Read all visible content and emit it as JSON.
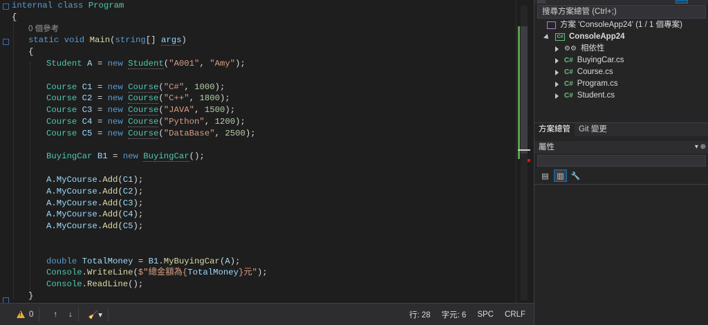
{
  "editor": {
    "code_lines": [
      {
        "kind": "class_decl",
        "kw1": "internal",
        "kw2": "class",
        "name": "Program"
      },
      {
        "kind": "brace",
        "text": "{"
      },
      {
        "kind": "hint",
        "text": "0 個參考"
      },
      {
        "kind": "method",
        "kw1": "static",
        "kw2": "void",
        "name": "Main",
        "p_open": "(",
        "ptype": "string",
        "pbr": "[]",
        "pname": "args",
        "p_close": ")"
      },
      {
        "kind": "brace",
        "text": "{"
      },
      {
        "kind": "new_obj",
        "type": "Student",
        "var": "A",
        "args": [
          {
            "s": "\"A001\""
          },
          {
            "s": "\"Amy\""
          }
        ]
      },
      {
        "kind": "blank"
      },
      {
        "kind": "new_obj",
        "type": "Course",
        "var": "C1",
        "args": [
          {
            "s": "\"C#\""
          },
          {
            "n": "1000"
          }
        ]
      },
      {
        "kind": "new_obj",
        "type": "Course",
        "var": "C2",
        "args": [
          {
            "s": "\"C++\""
          },
          {
            "n": "1800"
          }
        ]
      },
      {
        "kind": "new_obj",
        "type": "Course",
        "var": "C3",
        "args": [
          {
            "s": "\"JAVA\""
          },
          {
            "n": "1500"
          }
        ]
      },
      {
        "kind": "new_obj",
        "type": "Course",
        "var": "C4",
        "args": [
          {
            "s": "\"Python\""
          },
          {
            "n": "1200"
          }
        ]
      },
      {
        "kind": "new_obj",
        "type": "Course",
        "var": "C5",
        "args": [
          {
            "s": "\"DataBase\""
          },
          {
            "n": "2500"
          }
        ]
      },
      {
        "kind": "blank"
      },
      {
        "kind": "new_obj",
        "type": "BuyingCar",
        "var": "B1",
        "args": []
      },
      {
        "kind": "blank"
      },
      {
        "kind": "call",
        "obj": "A",
        "prop": "MyCourse",
        "fn": "Add",
        "arg": "C1"
      },
      {
        "kind": "call",
        "obj": "A",
        "prop": "MyCourse",
        "fn": "Add",
        "arg": "C2"
      },
      {
        "kind": "call",
        "obj": "A",
        "prop": "MyCourse",
        "fn": "Add",
        "arg": "C3"
      },
      {
        "kind": "call",
        "obj": "A",
        "prop": "MyCourse",
        "fn": "Add",
        "arg": "C4"
      },
      {
        "kind": "call",
        "obj": "A",
        "prop": "MyCourse",
        "fn": "Add",
        "arg": "C5"
      },
      {
        "kind": "blank"
      },
      {
        "kind": "blank"
      },
      {
        "kind": "assign_call",
        "tkw": "double",
        "var": "TotalMoney",
        "obj": "B1",
        "fn": "MyBuyingCar",
        "arg": "A"
      },
      {
        "kind": "writeline",
        "cls": "Console",
        "fn": "WriteLine",
        "s1": "$\"總金額為{",
        "interp": "TotalMoney",
        "s2": "}元\""
      },
      {
        "kind": "readline",
        "cls": "Console",
        "fn": "ReadLine"
      },
      {
        "kind": "brace",
        "text": "}"
      }
    ]
  },
  "statusbar": {
    "warnings": "0",
    "line": "行: 28",
    "col": "字元: 6",
    "spacing": "SPC",
    "line_ending": "CRLF"
  },
  "solution_explorer": {
    "search_placeholder": "搜尋方案總管 (Ctrl+;)",
    "solution_label": "方案 'ConsoleApp24' (1 / 1 個專案)",
    "project_label": "ConsoleApp24",
    "project_icon_text": "C#",
    "dependencies_label": "相依性",
    "file_icon_text": "C#",
    "files": [
      "BuyingCar.cs",
      "Course.cs",
      "Program.cs",
      "Student.cs"
    ],
    "tabs": [
      "方案總管",
      "Git 變更"
    ]
  },
  "properties": {
    "title": "屬性",
    "controls": "▾ ⊕"
  },
  "colors": {
    "keyword": "#569cd6",
    "type": "#4ec9b0",
    "string": "#d69d85",
    "number": "#b5cea8",
    "method": "#dcdcaa",
    "variable": "#9cdcfe",
    "change_margin": "#5aa248"
  }
}
